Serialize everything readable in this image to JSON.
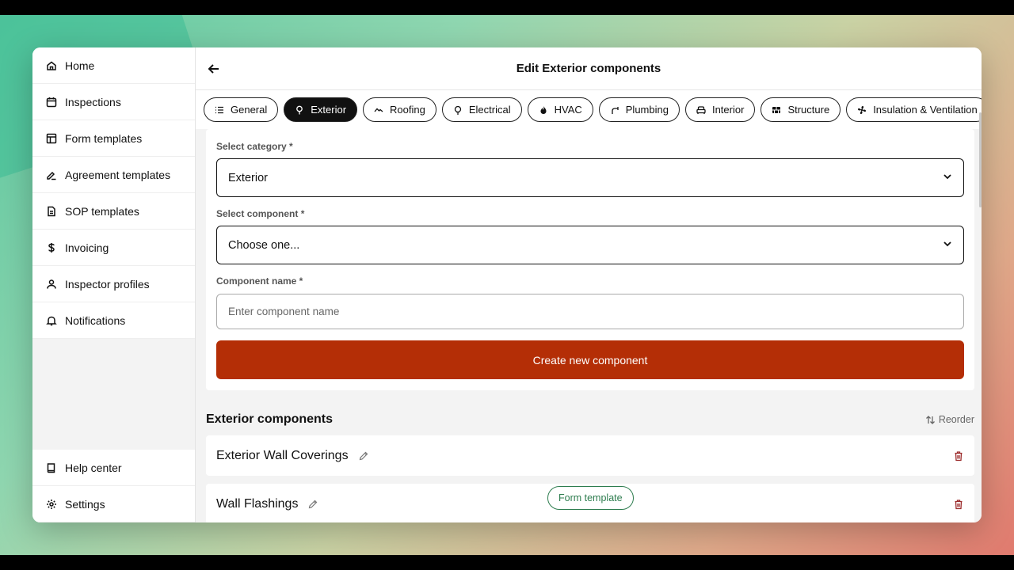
{
  "sidebar": {
    "items": [
      {
        "label": "Home",
        "icon": "home-icon"
      },
      {
        "label": "Inspections",
        "icon": "calendar-icon"
      },
      {
        "label": "Form templates",
        "icon": "layout-icon"
      },
      {
        "label": "Agreement templates",
        "icon": "signature-icon"
      },
      {
        "label": "SOP templates",
        "icon": "document-icon"
      },
      {
        "label": "Invoicing",
        "icon": "dollar-icon"
      },
      {
        "label": "Inspector profiles",
        "icon": "user-icon"
      },
      {
        "label": "Notifications",
        "icon": "bell-icon"
      }
    ],
    "bottom_items": [
      {
        "label": "Help center",
        "icon": "book-icon"
      },
      {
        "label": "Settings",
        "icon": "gear-icon"
      }
    ]
  },
  "header": {
    "title": "Edit Exterior components"
  },
  "tabs": [
    {
      "label": "General",
      "icon": "list-icon"
    },
    {
      "label": "Exterior",
      "icon": "tree-icon",
      "active": true
    },
    {
      "label": "Roofing",
      "icon": "roof-icon"
    },
    {
      "label": "Electrical",
      "icon": "bulb-icon"
    },
    {
      "label": "HVAC",
      "icon": "flame-icon"
    },
    {
      "label": "Plumbing",
      "icon": "pipe-icon"
    },
    {
      "label": "Interior",
      "icon": "sofa-icon"
    },
    {
      "label": "Structure",
      "icon": "bricks-icon"
    },
    {
      "label": "Insulation & Ventilation",
      "icon": "fan-icon"
    }
  ],
  "form": {
    "category_label": "Select category *",
    "category_value": "Exterior",
    "component_label": "Select component *",
    "component_value": "Choose one...",
    "name_label": "Component name *",
    "name_placeholder": "Enter component name",
    "create_button": "Create new component"
  },
  "components": {
    "title": "Exterior components",
    "reorder_label": "Reorder",
    "items": [
      {
        "name": "Exterior Wall Coverings"
      },
      {
        "name": "Wall Flashings"
      }
    ],
    "form_template_label": "Form template"
  },
  "colors": {
    "primary": "#b42e06",
    "active_tab": "#111111",
    "form_template": "#2e7d4f",
    "trash": "#9b2a2a"
  }
}
